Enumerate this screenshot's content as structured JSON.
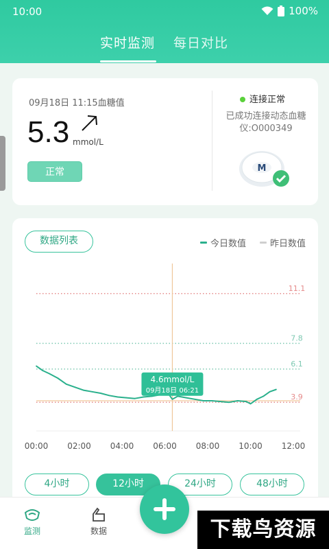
{
  "status_bar": {
    "time": "10:00",
    "battery": "100%"
  },
  "tabs": [
    {
      "label": "实时监测",
      "active": true
    },
    {
      "label": "每日对比",
      "active": false
    }
  ],
  "glucose": {
    "datetime": "09月18日 11:15血糖值",
    "value": "5.3",
    "unit": "mmol/L",
    "trend": "arrow-up-right",
    "status": "正常"
  },
  "device": {
    "connection": "连接正常",
    "description": "已成功连接动态血糖仪:O000349",
    "connected_color": "#5ad13b"
  },
  "chart_card": {
    "data_list_button": "数据列表",
    "legend": [
      {
        "label": "今日数值",
        "color": "#2ab08c"
      },
      {
        "label": "昨日数值",
        "color": "#cfcfcf"
      }
    ],
    "ranges": [
      {
        "label": "4小时",
        "active": false
      },
      {
        "label": "12小时",
        "active": true
      },
      {
        "label": "24小时",
        "active": false
      },
      {
        "label": "48小时",
        "active": false
      }
    ]
  },
  "chart_data": {
    "type": "line",
    "x_ticks": [
      "00:00",
      "02:00",
      "04:00",
      "06:00",
      "08:00",
      "10:00",
      "12:00"
    ],
    "xlim": [
      0,
      12
    ],
    "ylim": [
      2,
      13
    ],
    "reference_lines": [
      {
        "value": 11.1,
        "label": "11.1",
        "color": "#e58b8b"
      },
      {
        "value": 7.8,
        "label": "7.8",
        "color": "#7ec9b2"
      },
      {
        "value": 6.1,
        "label": "6.1",
        "color": "#7ec9b2"
      },
      {
        "value": 3.9,
        "label": "3.9",
        "color": "#e58b8b"
      }
    ],
    "series": [
      {
        "name": "今日数值",
        "color": "#2ab08c",
        "x": [
          0,
          0.3,
          0.6,
          1.0,
          1.4,
          1.8,
          2.2,
          2.6,
          3.0,
          3.4,
          3.8,
          4.2,
          4.6,
          5.0,
          5.4,
          5.8,
          6.1,
          6.35,
          6.6,
          7.0,
          7.4,
          7.8,
          8.2,
          8.6,
          9.0,
          9.4,
          9.8,
          10.0,
          10.3,
          10.6,
          10.9,
          11.2
        ],
        "y": [
          6.3,
          6.0,
          5.8,
          5.5,
          5.1,
          4.9,
          4.7,
          4.6,
          4.5,
          4.35,
          4.25,
          4.2,
          4.15,
          4.25,
          4.3,
          4.4,
          4.6,
          4.1,
          4.3,
          4.2,
          4.1,
          4.0,
          4.0,
          3.95,
          3.9,
          4.0,
          3.95,
          3.8,
          4.1,
          4.3,
          4.6,
          4.75
        ]
      }
    ],
    "tooltip": {
      "value": "4.6mmol/L",
      "time": "09月18日 06:21",
      "x": 6.35,
      "y": 4.6
    },
    "crosshair": {
      "x": 6.35,
      "y": 4.0
    }
  },
  "bottom_nav": {
    "items": [
      {
        "label": "监测",
        "icon": "monitor-icon",
        "active": true
      },
      {
        "label": "数据",
        "icon": "data-icon",
        "active": false
      }
    ],
    "fab_icon": "plus-icon"
  },
  "watermark": "下载鸟资源"
}
